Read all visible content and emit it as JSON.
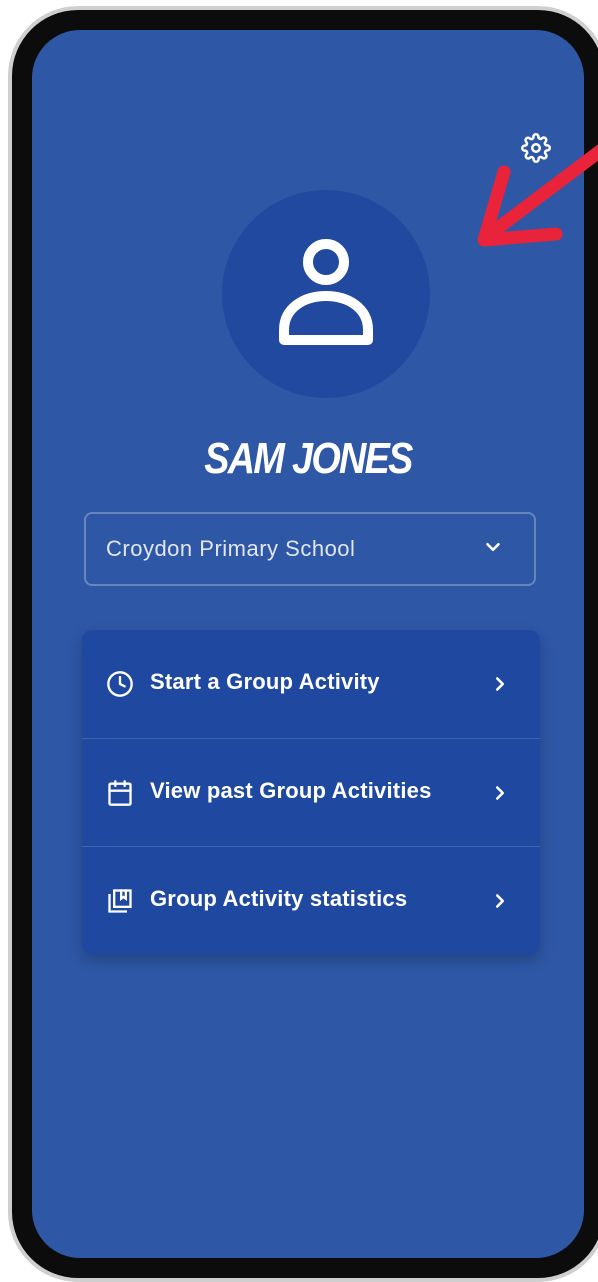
{
  "profile": {
    "name": "SAM JONES"
  },
  "school_select": {
    "selected": "Croydon Primary School"
  },
  "menu": {
    "items": [
      {
        "label": "Start a Group Activity",
        "icon": "clock-icon"
      },
      {
        "label": "View past Group Activities",
        "icon": "calendar-icon"
      },
      {
        "label": "Group Activity statistics",
        "icon": "statistics-book-icon"
      }
    ]
  },
  "colors": {
    "background": "#2e57a6",
    "card": "#1f49a0",
    "avatar": "#2149a0",
    "annotation_arrow": "#e8233a"
  }
}
